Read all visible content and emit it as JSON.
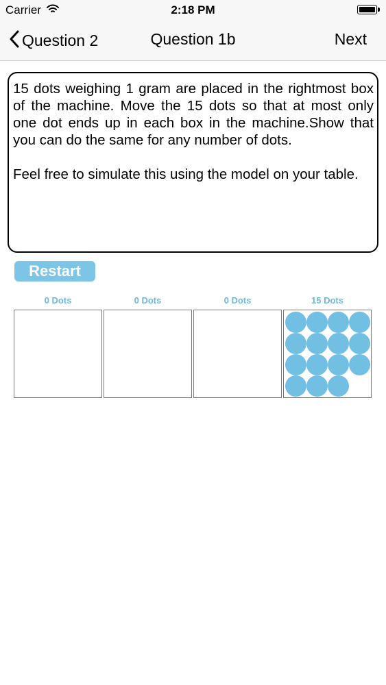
{
  "status_bar": {
    "carrier": "Carrier",
    "time": "2:18 PM"
  },
  "nav": {
    "back_label": "Question 2",
    "title": "Question 1b",
    "next_label": "Next"
  },
  "question": {
    "paragraph1": "15 dots weighing 1 gram are placed in the rightmost box of the machine. Move the 15 dots so that at most only one dot ends up in each box in the machine.Show that you can do the same for any number of dots.",
    "paragraph2": "Feel free to simulate this using the model on your table."
  },
  "restart_label": "Restart",
  "machine": {
    "boxes": [
      {
        "label": "0 Dots",
        "dots": 0
      },
      {
        "label": "0 Dots",
        "dots": 0
      },
      {
        "label": "0 Dots",
        "dots": 0
      },
      {
        "label": "15 Dots",
        "dots": 15
      }
    ],
    "dot_color": "#71c0e4",
    "label_color": "#6fb8d9",
    "button_color": "#7cc5e6"
  }
}
